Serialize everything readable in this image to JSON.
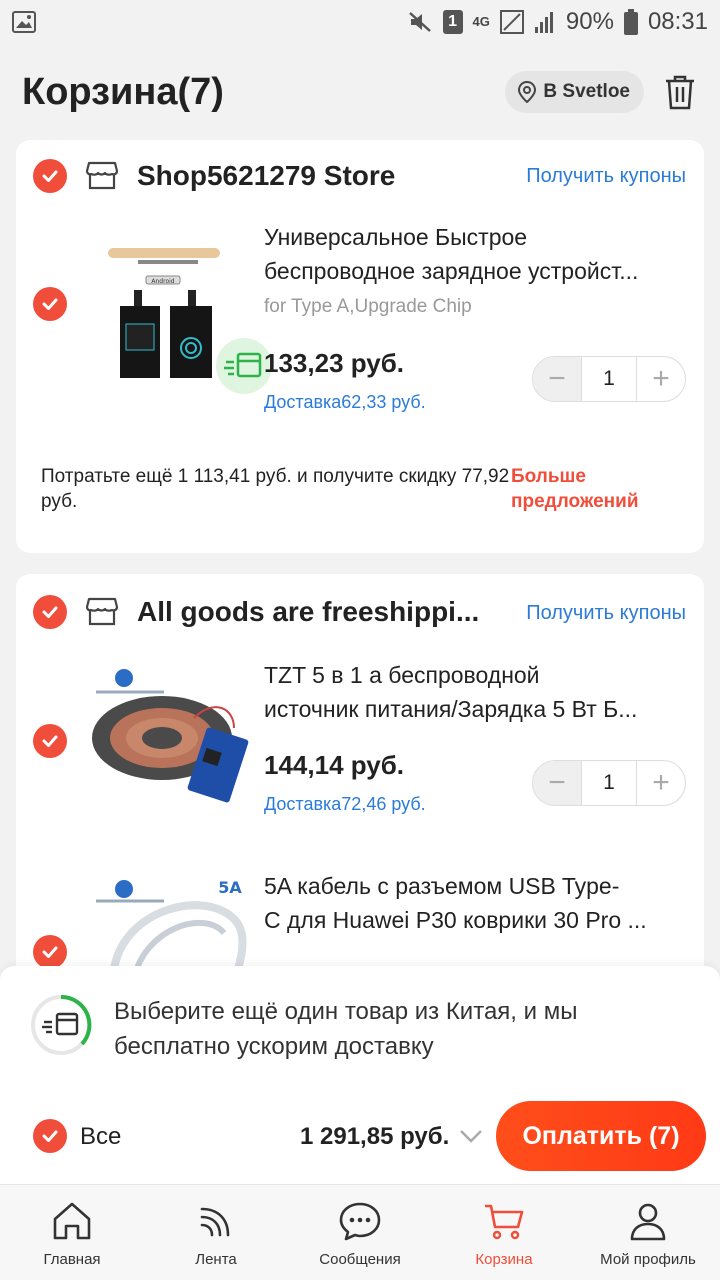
{
  "status_bar": {
    "battery": "90%",
    "time": "08:31",
    "sim_badge": "1",
    "network": "4G"
  },
  "header": {
    "title": "Корзина(7)",
    "location": "В Svetloe"
  },
  "stores": [
    {
      "name": "Shop5621279 Store",
      "coupon_label": "Получить купоны",
      "products": [
        {
          "name_line1": "Универсальное Быстрое",
          "name_line2": "беспроводное зарядное устройст...",
          "variant": "for Type A,Upgrade Chip",
          "price": "133,23 руб.",
          "shipping": "Доставка62,33 руб.",
          "qty": "1",
          "thumb_label": "Android"
        }
      ],
      "promo_text": "Потратьте ещё 1 113,41 руб. и получите скидку 77,92 руб.",
      "promo_more": "Больше предложений"
    },
    {
      "name": "All goods are freeshippi...",
      "coupon_label": "Получить купоны",
      "products": [
        {
          "name_line1": "TZT 5 в 1 а беспроводной",
          "name_line2": "источник питания/Зарядка 5 Вт Б...",
          "price": "144,14 руб.",
          "shipping": "Доставка72,46 руб.",
          "qty": "1"
        },
        {
          "name_line1": "5A кабель с разъемом USB Type-",
          "name_line2": "C для Huawei P30 коврики 30 Pro ...",
          "thumb_badge": "5A"
        }
      ]
    }
  ],
  "bottom_sheet": {
    "boost_text": "Выберите ещё один товар из Китая, и мы бесплатно ускорим доставку",
    "all_label": "Все",
    "total": "1 291,85 руб.",
    "pay_button": "Оплатить (7)"
  },
  "tabs": [
    {
      "label": "Главная",
      "icon": "home-icon"
    },
    {
      "label": "Лента",
      "icon": "feed-icon"
    },
    {
      "label": "Сообщения",
      "icon": "messages-icon"
    },
    {
      "label": "Корзина",
      "icon": "cart-icon",
      "active": true
    },
    {
      "label": "Мой профиль",
      "icon": "profile-icon"
    }
  ],
  "colors": {
    "accent": "#f04e3a",
    "link": "#2b7bd8",
    "pay_button": "#ff4e1a"
  }
}
